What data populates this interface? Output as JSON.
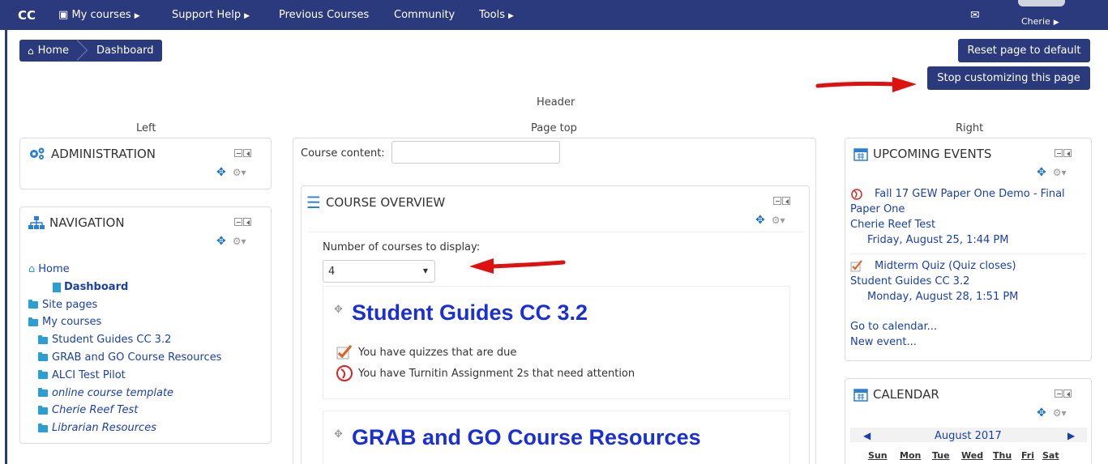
{
  "topnav": {
    "brand": "CC",
    "items": [
      "My courses",
      "Support Help",
      "Previous Courses",
      "Community",
      "Tools"
    ],
    "user": "Cherie"
  },
  "breadcrumb": {
    "home": "Home",
    "dashboard": "Dashboard"
  },
  "buttons": {
    "reset": "Reset page to default",
    "stop": "Stop customizing this page"
  },
  "regions": {
    "header": "Header",
    "left": "Left",
    "pagetop": "Page top",
    "right": "Right"
  },
  "administration": {
    "title": "ADMINISTRATION"
  },
  "navigation": {
    "title": "NAVIGATION",
    "home": "Home",
    "dashboard": "Dashboard",
    "site_pages": "Site pages",
    "my_courses": "My courses",
    "courses": [
      "Student Guides CC 3.2",
      "GRAB and GO Course Resources",
      "ALCI Test Pilot",
      "online course template",
      "Cherie Reef Test",
      "Librarian Resources"
    ]
  },
  "course_content": {
    "label": "Course content:",
    "value": ""
  },
  "overview": {
    "title": "COURSE OVERVIEW",
    "display_label": "Number of courses to display:",
    "display_value": "4",
    "course1": {
      "title": "Student Guides CC 3.2",
      "note1": "You have quizzes that are due",
      "note2": "You have Turnitin Assignment 2s that need attention"
    },
    "course2": {
      "title": "GRAB and GO Course Resources"
    }
  },
  "upcoming": {
    "title": "UPCOMING EVENTS",
    "event1_line1": "Fall 17 GEW Paper One Demo - Final",
    "event1_line2": "Paper One",
    "event1_course": "Cherie Reef Test",
    "event1_date": "Friday, August 25, 1:44 PM",
    "event2_title": "Midterm Quiz (Quiz closes)",
    "event2_course": "Student Guides CC 3.2",
    "event2_date": "Monday, August 28, 1:51 PM",
    "goto": "Go to calendar...",
    "new_event": "New event..."
  },
  "calendar": {
    "title": "CALENDAR",
    "month": "August 2017",
    "days": [
      "Sun",
      "Mon",
      "Tue",
      "Wed",
      "Thu",
      "Fri",
      "Sat"
    ]
  },
  "colors": {
    "navbar": "#2a3a7c",
    "link": "#1a3fa8",
    "course_title": "#1a2fd6",
    "arrow": "#e01010"
  }
}
